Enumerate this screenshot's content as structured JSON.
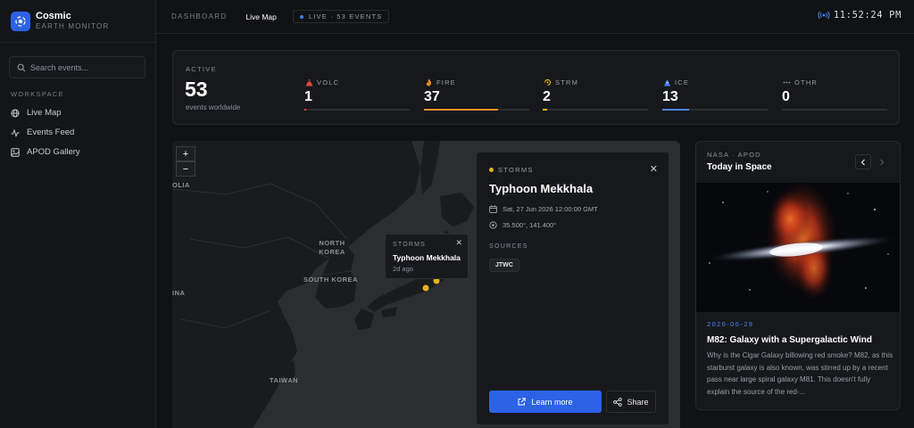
{
  "brand": {
    "title": "Cosmic",
    "subtitle": "EARTH MONITOR"
  },
  "search": {
    "placeholder": "Search events..."
  },
  "sidebar": {
    "section_label": "WORKSPACE",
    "items": [
      {
        "label": "Live Map",
        "icon": "globe-icon"
      },
      {
        "label": "Events Feed",
        "icon": "activity-icon"
      },
      {
        "label": "APOD Gallery",
        "icon": "image-icon"
      }
    ]
  },
  "topbar": {
    "crumb": "DASHBOARD",
    "current": "Live Map",
    "live": "LIVE · 53 EVENTS",
    "clock": "11:52:24 PM"
  },
  "stats": {
    "active_label": "ACTIVE",
    "active_count": "53",
    "active_sub": "events worldwide",
    "items": [
      {
        "code": "VOLC",
        "value": "1",
        "fraction": 0.02,
        "color": "#e2463c",
        "icon": "volcano-icon"
      },
      {
        "code": "FIRE",
        "value": "37",
        "fraction": 0.7,
        "color": "#e8912d",
        "icon": "fire-icon"
      },
      {
        "code": "STRM",
        "value": "2",
        "fraction": 0.04,
        "color": "#e2b21c",
        "icon": "storm-icon"
      },
      {
        "code": "ICE",
        "value": "13",
        "fraction": 0.25,
        "color": "#4a86f5",
        "icon": "ice-icon"
      },
      {
        "code": "OTHR",
        "value": "0",
        "fraction": 0,
        "color": "#7a7d85",
        "icon": "more-icon"
      }
    ]
  },
  "map": {
    "zoom_in": "+",
    "zoom_out": "−",
    "labels": [
      "OLIA",
      "NORTH KOREA",
      "SOUTH KOREA",
      "INA",
      "TAIWAN"
    ],
    "tooltip": {
      "category": "STORMS",
      "name": "Typhoon Mekkhala",
      "age": "2d ago",
      "close": "✕"
    }
  },
  "detail": {
    "category": "STORMS",
    "title": "Typhoon Mekkhala",
    "date": "Sat, 27 Jun 2026 12:00:00 GMT",
    "coords": "35.500°, 141.400°",
    "sources_label": "SOURCES",
    "source": "JTWC",
    "learn_more": "Learn more",
    "share": "Share",
    "close": "✕",
    "accent": "#e2b21c"
  },
  "apod": {
    "source": "NASA · APOD",
    "title": "Today in Space",
    "date": "2026-06-29",
    "headline": "M82: Galaxy with a Supergalactic Wind",
    "description": "Why is the Cigar Galaxy billowing red smoke? M82, as this starburst galaxy is also known, was stirred up by a recent pass near large spiral galaxy M81. This doesn't fully explain the source of the red-..."
  }
}
